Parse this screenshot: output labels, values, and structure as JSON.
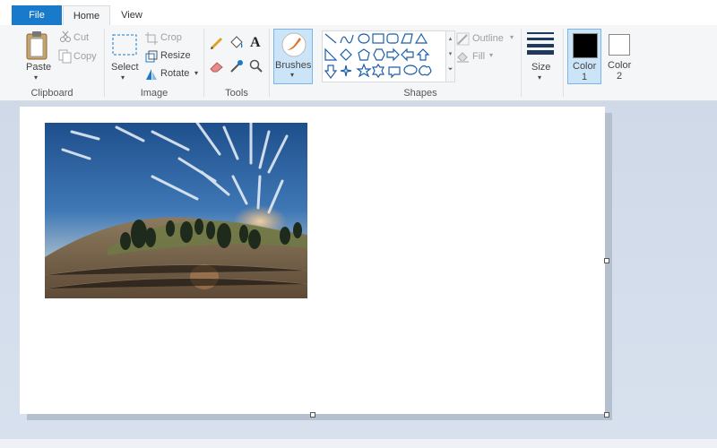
{
  "tabs": [
    {
      "label": "File"
    },
    {
      "label": "Home"
    },
    {
      "label": "View"
    }
  ],
  "clipboard": {
    "group_label": "Clipboard",
    "paste": "Paste",
    "cut": "Cut",
    "copy": "Copy"
  },
  "image": {
    "group_label": "Image",
    "select": "Select",
    "crop": "Crop",
    "resize": "Resize",
    "rotate": "Rotate"
  },
  "tools": {
    "group_label": "Tools",
    "icons": [
      "pencil-icon",
      "fill-bucket-icon",
      "text-icon",
      "eraser-icon",
      "color-picker-icon",
      "magnifier-icon"
    ]
  },
  "brushes": {
    "label": "Brushes"
  },
  "shapes": {
    "group_label": "Shapes",
    "outline": "Outline",
    "fill": "Fill"
  },
  "size": {
    "label": "Size"
  },
  "colors": {
    "color1": "Color",
    "color1_num": "1",
    "color2": "Color",
    "color2_num": "2",
    "color1_value": "#000000",
    "color2_value": "#ffffff"
  },
  "theme": {
    "file_tab_bg": "#1979ca",
    "ribbon_bg": "#f5f6f7",
    "selected_bg": "#cce4f7",
    "selected_border": "#7eb4ea",
    "canvas_bg": "#c9d4e4"
  },
  "canvas": {
    "image_description_icon": "landscape-photo"
  }
}
